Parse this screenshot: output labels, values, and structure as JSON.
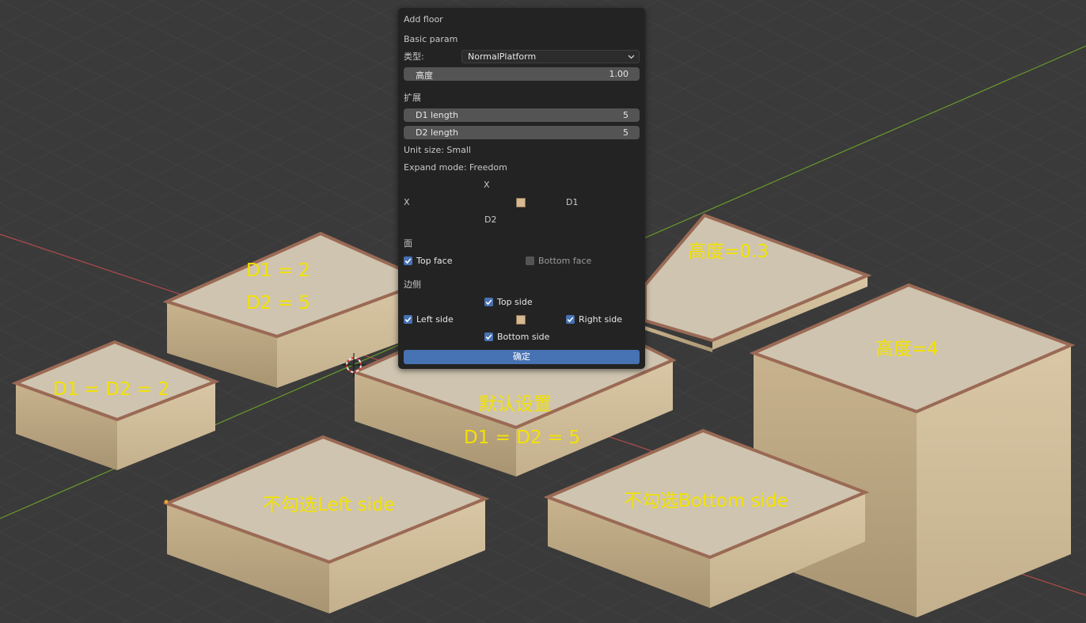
{
  "viewport": {
    "annotations": {
      "left_top_1": "D1 = 2",
      "left_top_2": "D2 = 5",
      "left_mid": "D1 = D2 = 2",
      "center_1": "默认设置",
      "center_2": "D1 = D2 = 5",
      "top_right": "高度=0.3",
      "right": "高度=4",
      "bottom_left": "不勾选Left side",
      "bottom_right": "不勾选Bottom side"
    }
  },
  "panel": {
    "title": "Add floor",
    "basic_section": "Basic param",
    "type_label": "类型:",
    "type_value": "NormalPlatform",
    "height_label": "高度",
    "height_value": "1.00",
    "expand_section": "扩展",
    "d1_label": "D1 length",
    "d1_value": "5",
    "d2_label": "D2 length",
    "d2_value": "5",
    "unit_size": "Unit size: Small",
    "expand_mode": "Expand mode: Freedom",
    "dir_top": "X",
    "dir_left": "X",
    "dir_right": "D1",
    "dir_bottom": "D2",
    "face_section": "面",
    "top_face": "Top face",
    "top_face_checked": true,
    "bottom_face": "Bottom face",
    "bottom_face_checked": false,
    "side_section": "边侧",
    "top_side": "Top side",
    "left_side": "Left side",
    "right_side": "Right side",
    "bottom_side": "Bottom side",
    "confirm": "确定"
  },
  "colors": {
    "accent": "#4772b3",
    "annotation": "#f2e200",
    "panel_bg": "#232323",
    "swatch": "#d6b991"
  }
}
